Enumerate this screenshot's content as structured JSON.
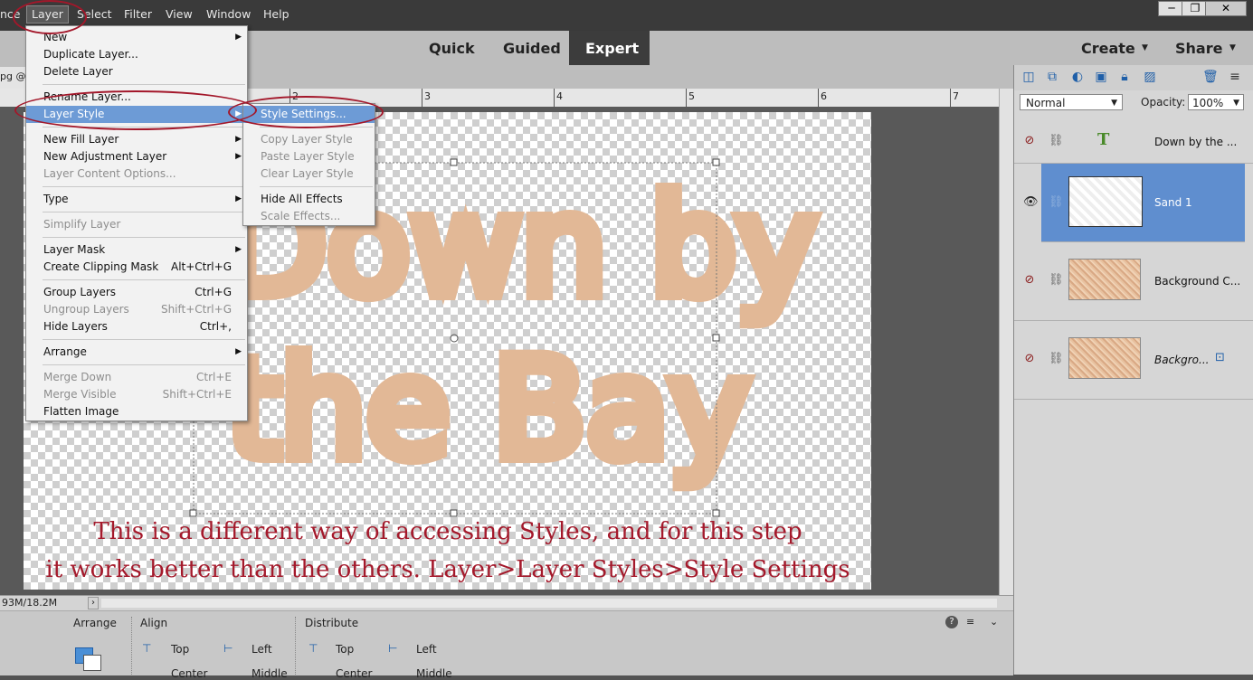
{
  "menubar": {
    "items": [
      "nce",
      "Layer",
      "Select",
      "Filter",
      "View",
      "Window",
      "Help"
    ],
    "window_controls": [
      "─",
      "❐",
      "✕"
    ]
  },
  "modes": {
    "quick": "Quick",
    "guided": "Guided",
    "expert": "Expert",
    "create": "Create",
    "share": "Share"
  },
  "doc_tab": "pg @",
  "ruler": [
    "2",
    "3",
    "4",
    "5",
    "6",
    "7"
  ],
  "status": {
    "size": "93M/18.2M"
  },
  "layer_menu": {
    "groups": [
      [
        {
          "label": "New",
          "submenu": true
        },
        {
          "label": "Duplicate Layer..."
        },
        {
          "label": "Delete Layer"
        }
      ],
      [
        {
          "label": "Rename Layer..."
        },
        {
          "label": "Layer Style",
          "submenu": true,
          "highlighted": true
        }
      ],
      [
        {
          "label": "New Fill Layer",
          "submenu": true
        },
        {
          "label": "New Adjustment Layer",
          "submenu": true
        },
        {
          "label": "Layer Content Options...",
          "disabled": true
        }
      ],
      [
        {
          "label": "Type",
          "submenu": true
        }
      ],
      [
        {
          "label": "Simplify Layer",
          "disabled": true
        }
      ],
      [
        {
          "label": "Layer Mask",
          "submenu": true
        },
        {
          "label": "Create Clipping Mask",
          "shortcut": "Alt+Ctrl+G"
        }
      ],
      [
        {
          "label": "Group Layers",
          "shortcut": "Ctrl+G"
        },
        {
          "label": "Ungroup Layers",
          "shortcut": "Shift+Ctrl+G",
          "disabled": true
        },
        {
          "label": "Hide Layers",
          "shortcut": "Ctrl+,"
        }
      ],
      [
        {
          "label": "Arrange",
          "submenu": true
        }
      ],
      [
        {
          "label": "Merge Down",
          "shortcut": "Ctrl+E",
          "disabled": true
        },
        {
          "label": "Merge Visible",
          "shortcut": "Shift+Ctrl+E",
          "disabled": true
        },
        {
          "label": "Flatten Image"
        }
      ]
    ]
  },
  "style_submenu": {
    "groups": [
      [
        {
          "label": "Style Settings...",
          "highlighted": true
        }
      ],
      [
        {
          "label": "Copy Layer Style",
          "disabled": true
        },
        {
          "label": "Paste Layer Style",
          "disabled": true
        },
        {
          "label": "Clear Layer Style",
          "disabled": true
        }
      ],
      [
        {
          "label": "Hide All Effects"
        },
        {
          "label": "Scale Effects...",
          "disabled": true
        }
      ]
    ]
  },
  "canvas": {
    "line1": "Down by",
    "line2": "the Bay"
  },
  "caption": {
    "line1": "This is a different way of accessing Styles, and for this step",
    "line2": "it works better than the others. Layer>Layer Styles>Style Settings"
  },
  "layers_panel": {
    "blend_mode": "Normal",
    "opacity_label": "Opacity:",
    "opacity_value": "100%",
    "layers": [
      {
        "name": "Down by the ...",
        "type": "text"
      },
      {
        "name": "Sand 1",
        "selected": true
      },
      {
        "name": "Background C..."
      },
      {
        "name": "Backgro...",
        "italic": true
      }
    ]
  },
  "tool_options": {
    "arrange": "Arrange",
    "align": "Align",
    "distribute": "Distribute",
    "align_items": [
      "Top",
      "Left",
      "Center",
      "Middle"
    ],
    "distribute_items": [
      "Top",
      "Left",
      "Center",
      "Middle"
    ]
  },
  "colors": {
    "accent_highlight": "#6d9bd6",
    "annotation_red": "#a4192b",
    "selected_layer": "#5f8ecf",
    "sand": "#e2b896"
  }
}
